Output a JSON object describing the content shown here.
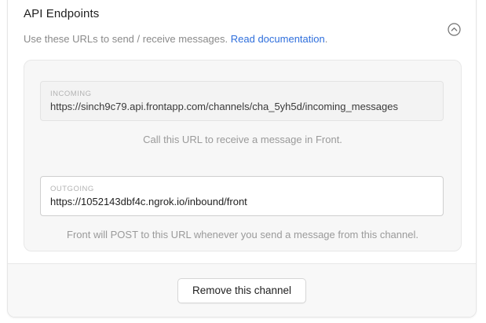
{
  "section": {
    "title": "API Endpoints",
    "subtitle_text": "Use these URLs to send / receive messages.",
    "doc_link_label": "Read documentation",
    "subtitle_suffix": ".",
    "collapse_icon": "chevron-up-circle-icon"
  },
  "incoming": {
    "label": "INCOMING",
    "url": "https://sinch9c79.api.frontapp.com/channels/cha_5yh5d/incoming_messages",
    "hint": "Call this URL to receive a message in Front."
  },
  "outgoing": {
    "label": "OUTGOING",
    "url": "https://1052143dbf4c.ngrok.io/inbound/front",
    "hint": "Front will POST to this URL whenever you send a message from this channel."
  },
  "footer": {
    "remove_label": "Remove this channel"
  },
  "colors": {
    "link": "#2f6fdc",
    "muted_text": "#8a8a8a",
    "panel_bg": "#f7f7f7"
  }
}
